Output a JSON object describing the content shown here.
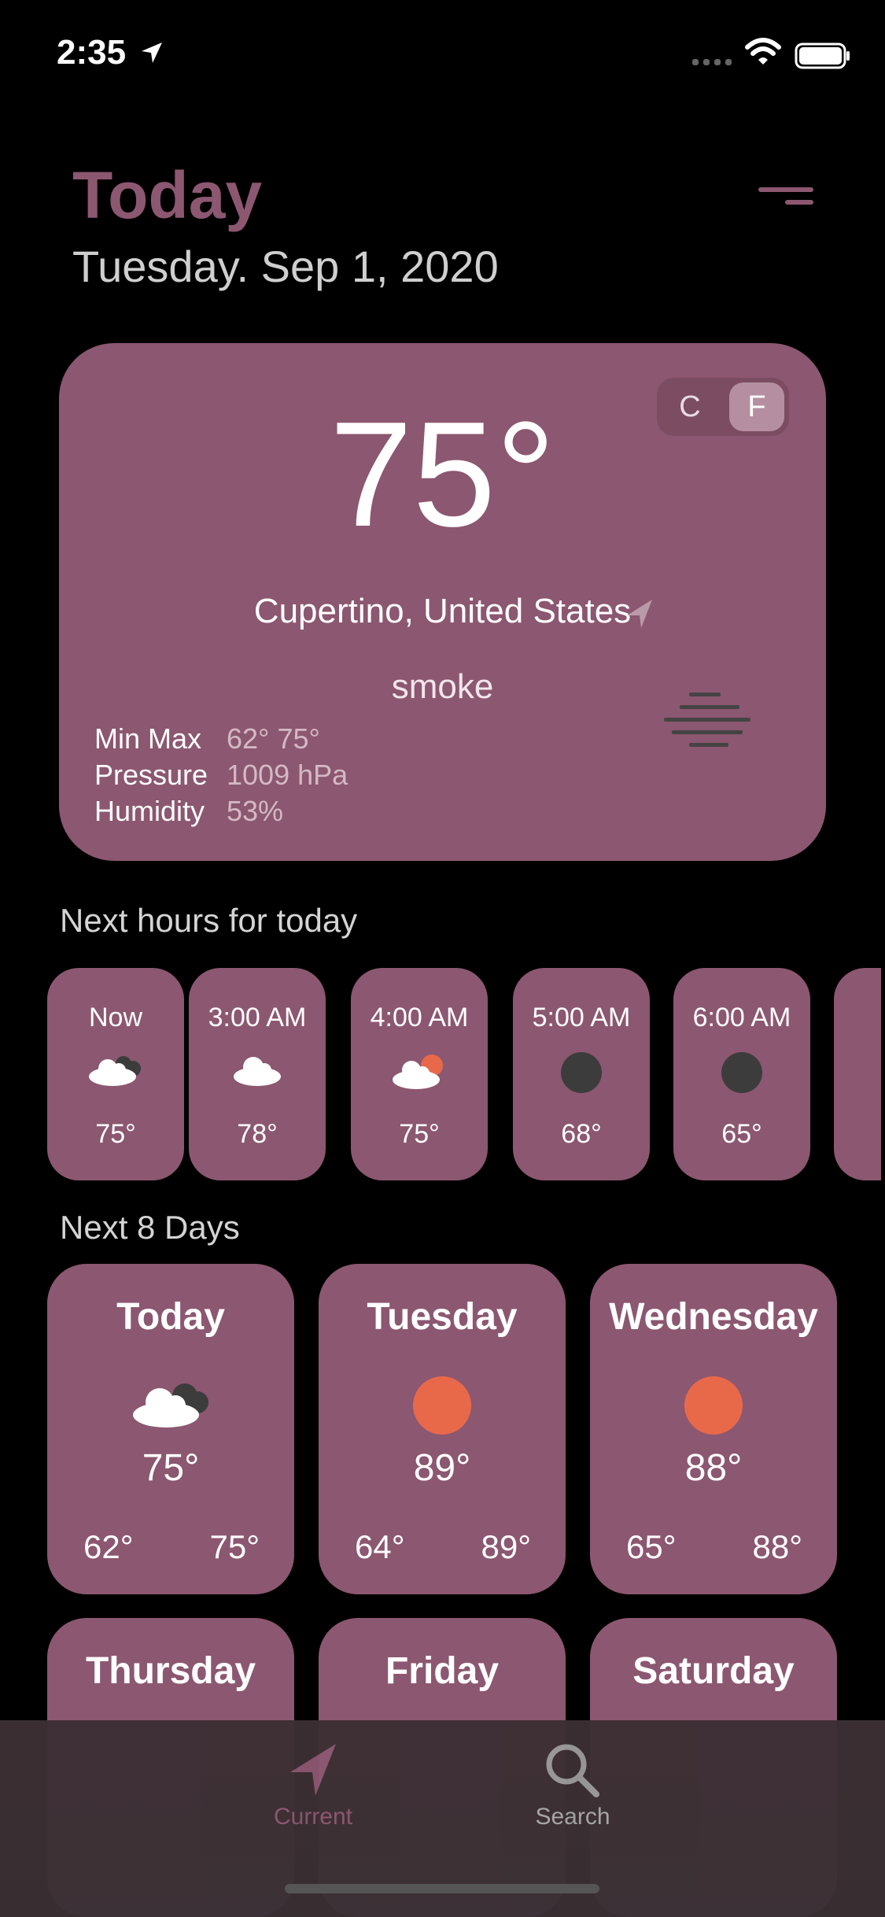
{
  "status_bar": {
    "time": "2:35"
  },
  "header": {
    "title": "Today",
    "date": "Tuesday. Sep 1, 2020"
  },
  "current": {
    "unit_c": "C",
    "unit_f": "F",
    "temperature": "75°",
    "location": "Cupertino, United States",
    "description": "smoke",
    "min_max_label": "Min  Max",
    "min_max_value": "62°  75°",
    "pressure_label": "Pressure",
    "pressure_value": "1009 hPa",
    "humidity_label": "Humidity",
    "humidity_value": "53%"
  },
  "hourly": {
    "title": "Next hours for today",
    "items": [
      {
        "label": "Now",
        "temp": "75°",
        "icon": "cloudy-night-icon"
      },
      {
        "label": "3:00 AM",
        "temp": "78°",
        "icon": "cloud-icon"
      },
      {
        "label": "4:00 AM",
        "temp": "75°",
        "icon": "partly-cloudy-icon"
      },
      {
        "label": "5:00 AM",
        "temp": "68°",
        "icon": "moon-icon"
      },
      {
        "label": "6:00 AM",
        "temp": "65°",
        "icon": "moon-icon"
      }
    ]
  },
  "daily": {
    "title": "Next 8 Days",
    "items": [
      {
        "name": "Today",
        "temp": "75°",
        "min": "62°",
        "max": "75°",
        "icon": "cloudy-icon"
      },
      {
        "name": "Tuesday",
        "temp": "89°",
        "min": "64°",
        "max": "89°",
        "icon": "sun-icon"
      },
      {
        "name": "Wednesday",
        "temp": "88°",
        "min": "65°",
        "max": "88°",
        "icon": "sun-icon"
      },
      {
        "name": "Thursday"
      },
      {
        "name": "Friday"
      },
      {
        "name": "Saturday"
      }
    ]
  },
  "tabbar": {
    "current_label": "Current",
    "search_label": "Search"
  },
  "colors": {
    "accent": "#8c5770",
    "sun": "#e8694a",
    "moon": "#3c3c3c"
  }
}
